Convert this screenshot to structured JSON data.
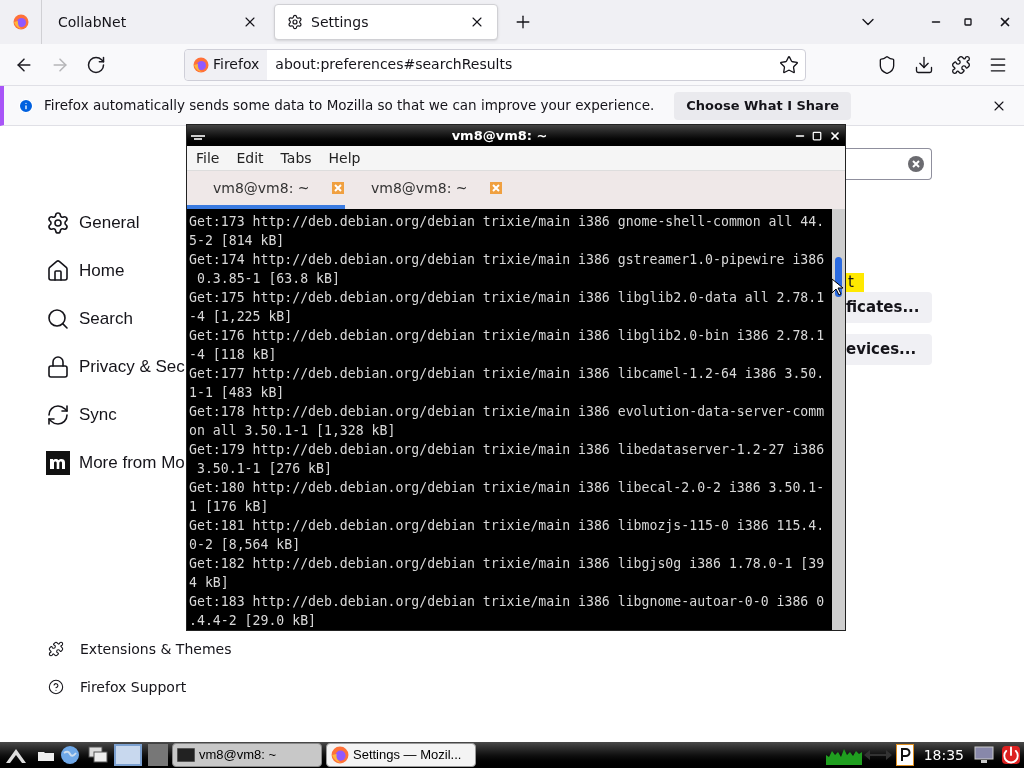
{
  "browser_tabs": [
    {
      "kind": "firefox",
      "selected": false
    },
    {
      "kind": "page",
      "label": "CollabNet",
      "selected": false
    },
    {
      "kind": "settings",
      "label": "Settings",
      "selected": true
    }
  ],
  "nav_buttons": [
    {
      "kind": "back",
      "disabled": false
    },
    {
      "kind": "forward",
      "disabled": true
    },
    {
      "kind": "reload",
      "disabled": false
    }
  ],
  "address_bar": {
    "identity": "Firefox",
    "url": "about:preferences#searchResults"
  },
  "notification": {
    "message": "Firefox automatically sends some data to Mozilla so that we can improve your experience.",
    "button": "Choose What I Share"
  },
  "sidebar": {
    "items": [
      {
        "kind": "general",
        "label": "General",
        "selected": false
      },
      {
        "kind": "home",
        "label": "Home",
        "selected": false
      },
      {
        "kind": "search",
        "label": "Search",
        "selected": false
      },
      {
        "kind": "privacy",
        "label": "Privacy & Sec",
        "selected": false
      },
      {
        "kind": "sync",
        "label": "Sync",
        "selected": false
      },
      {
        "kind": "more",
        "label": "More from Mo",
        "selected": false
      }
    ],
    "footer": [
      {
        "kind": "extensions",
        "label": "Extensions & Themes"
      },
      {
        "kind": "support",
        "label": "Firefox Support"
      }
    ]
  },
  "results": {
    "highlight": "t",
    "buttons": [
      "ficates...",
      "evices..."
    ]
  },
  "terminal": {
    "title": "vm8@vm8: ~",
    "menu": [
      "File",
      "Edit",
      "Tabs",
      "Help"
    ],
    "tabs": [
      {
        "label": "vm8@vm8: ~",
        "selected": true
      },
      {
        "label": "vm8@vm8: ~",
        "selected": false
      }
    ],
    "lines": [
      "Get:173 http://deb.debian.org/debian trixie/main i386 gnome-shell-common all 44.",
      "5-2 [814 kB]",
      "Get:174 http://deb.debian.org/debian trixie/main i386 gstreamer1.0-pipewire i386",
      " 0.3.85-1 [63.8 kB]",
      "Get:175 http://deb.debian.org/debian trixie/main i386 libglib2.0-data all 2.78.1",
      "-4 [1,225 kB]",
      "Get:176 http://deb.debian.org/debian trixie/main i386 libglib2.0-bin i386 2.78.1",
      "-4 [118 kB]",
      "Get:177 http://deb.debian.org/debian trixie/main i386 libcamel-1.2-64 i386 3.50.",
      "1-1 [483 kB]",
      "Get:178 http://deb.debian.org/debian trixie/main i386 evolution-data-server-comm",
      "on all 3.50.1-1 [1,328 kB]",
      "Get:179 http://deb.debian.org/debian trixie/main i386 libedataserver-1.2-27 i386",
      " 3.50.1-1 [276 kB]",
      "Get:180 http://deb.debian.org/debian trixie/main i386 libecal-2.0-2 i386 3.50.1-",
      "1 [176 kB]",
      "Get:181 http://deb.debian.org/debian trixie/main i386 libmozjs-115-0 i386 115.4.",
      "0-2 [8,564 kB]",
      "Get:182 http://deb.debian.org/debian trixie/main i386 libgjs0g i386 1.78.0-1 [39",
      "4 kB]",
      "Get:183 http://deb.debian.org/debian trixie/main i386 libgnome-autoar-0-0 i386 0",
      ".4.4-2 [29.0 kB]"
    ]
  },
  "taskbar": {
    "tasks": [
      {
        "kind": "terminal",
        "label": "vm8@vm8: ~",
        "selected": false
      },
      {
        "kind": "firefox",
        "label": "Settings — Mozil...",
        "selected": true
      }
    ],
    "clock": "18:35"
  }
}
